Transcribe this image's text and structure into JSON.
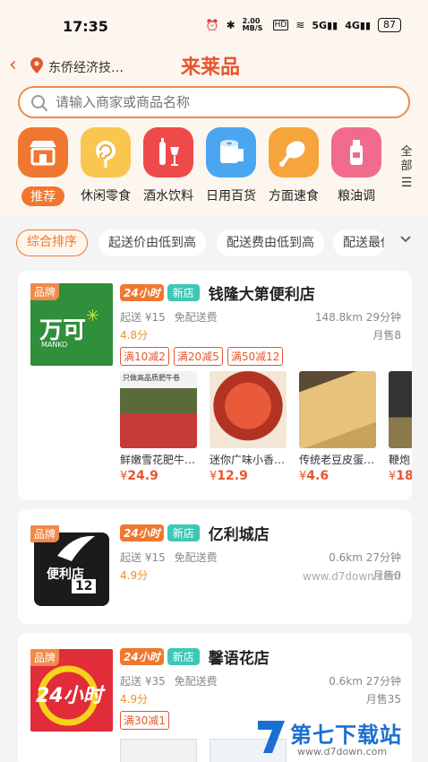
{
  "status_bar": {
    "time": "17:35",
    "net_speed": "2.00 MB/S",
    "battery": "87"
  },
  "nav": {
    "location": "东侨经济技…",
    "title": "来莱品"
  },
  "search": {
    "placeholder": "请输入商家或商品名称"
  },
  "categories": [
    {
      "label": "推荐",
      "icon": "shop-icon",
      "active": true
    },
    {
      "label": "休闲零食",
      "icon": "lollipop-icon"
    },
    {
      "label": "酒水饮料",
      "icon": "wine-icon"
    },
    {
      "label": "日用百货",
      "icon": "tissue-roll-icon"
    },
    {
      "label": "方面速食",
      "icon": "drumstick-icon"
    },
    {
      "label": "粮油调",
      "icon": "bottle-icon"
    }
  ],
  "all_label": "全部",
  "filters": [
    "综合排序",
    "起送价由低到高",
    "配送费由低到高",
    "配送最低"
  ],
  "stores": [
    {
      "brand_tag": "品牌",
      "logo_text": "万可",
      "logo_sub": "MANKO",
      "badge_24": "24小时",
      "badge_new": "新店",
      "name": "钱隆大第便利店",
      "min_order": "起送 ¥15",
      "delivery": "免配送费",
      "distance": "148.8km 29分钟",
      "rating": "4.8分",
      "monthly": "月售8",
      "promos": [
        "满10减2",
        "满20减5",
        "满50减12"
      ],
      "products": [
        {
          "name": "鲜嫩雪花肥牛…",
          "price_symbol": "¥",
          "price": "24.9",
          "img_caption": "只做高品质肥牛卷"
        },
        {
          "name": "迷你广味小香…",
          "price_symbol": "¥",
          "price": "12.9"
        },
        {
          "name": "传统老豆皮蛋…",
          "price_symbol": "¥",
          "price": "4.6"
        },
        {
          "name": "鞭炮",
          "price_symbol": "¥",
          "price": "18"
        }
      ]
    },
    {
      "brand_tag": "品牌",
      "logo_text": "便利店",
      "logo_num": "12",
      "badge_24": "24小时",
      "badge_new": "新店",
      "name": "亿利城店",
      "min_order": "起送 ¥15",
      "delivery": "免配送费",
      "distance": "0.6km 27分钟",
      "rating": "4.9分",
      "monthly": "月售0",
      "promos": []
    },
    {
      "brand_tag": "品牌",
      "logo_text": "24小时",
      "badge_24": "24小时",
      "badge_new": "新店",
      "name": "馨语花店",
      "min_order": "起送 ¥35",
      "delivery": "免配送费",
      "distance": "0.6km 27分钟",
      "rating": "4.9分",
      "monthly": "月售35",
      "promos": [
        "满30减1"
      ]
    }
  ],
  "watermark": {
    "text": "第七下载站",
    "url": "www.d7down.com"
  },
  "site_url": "www.d7down.com"
}
